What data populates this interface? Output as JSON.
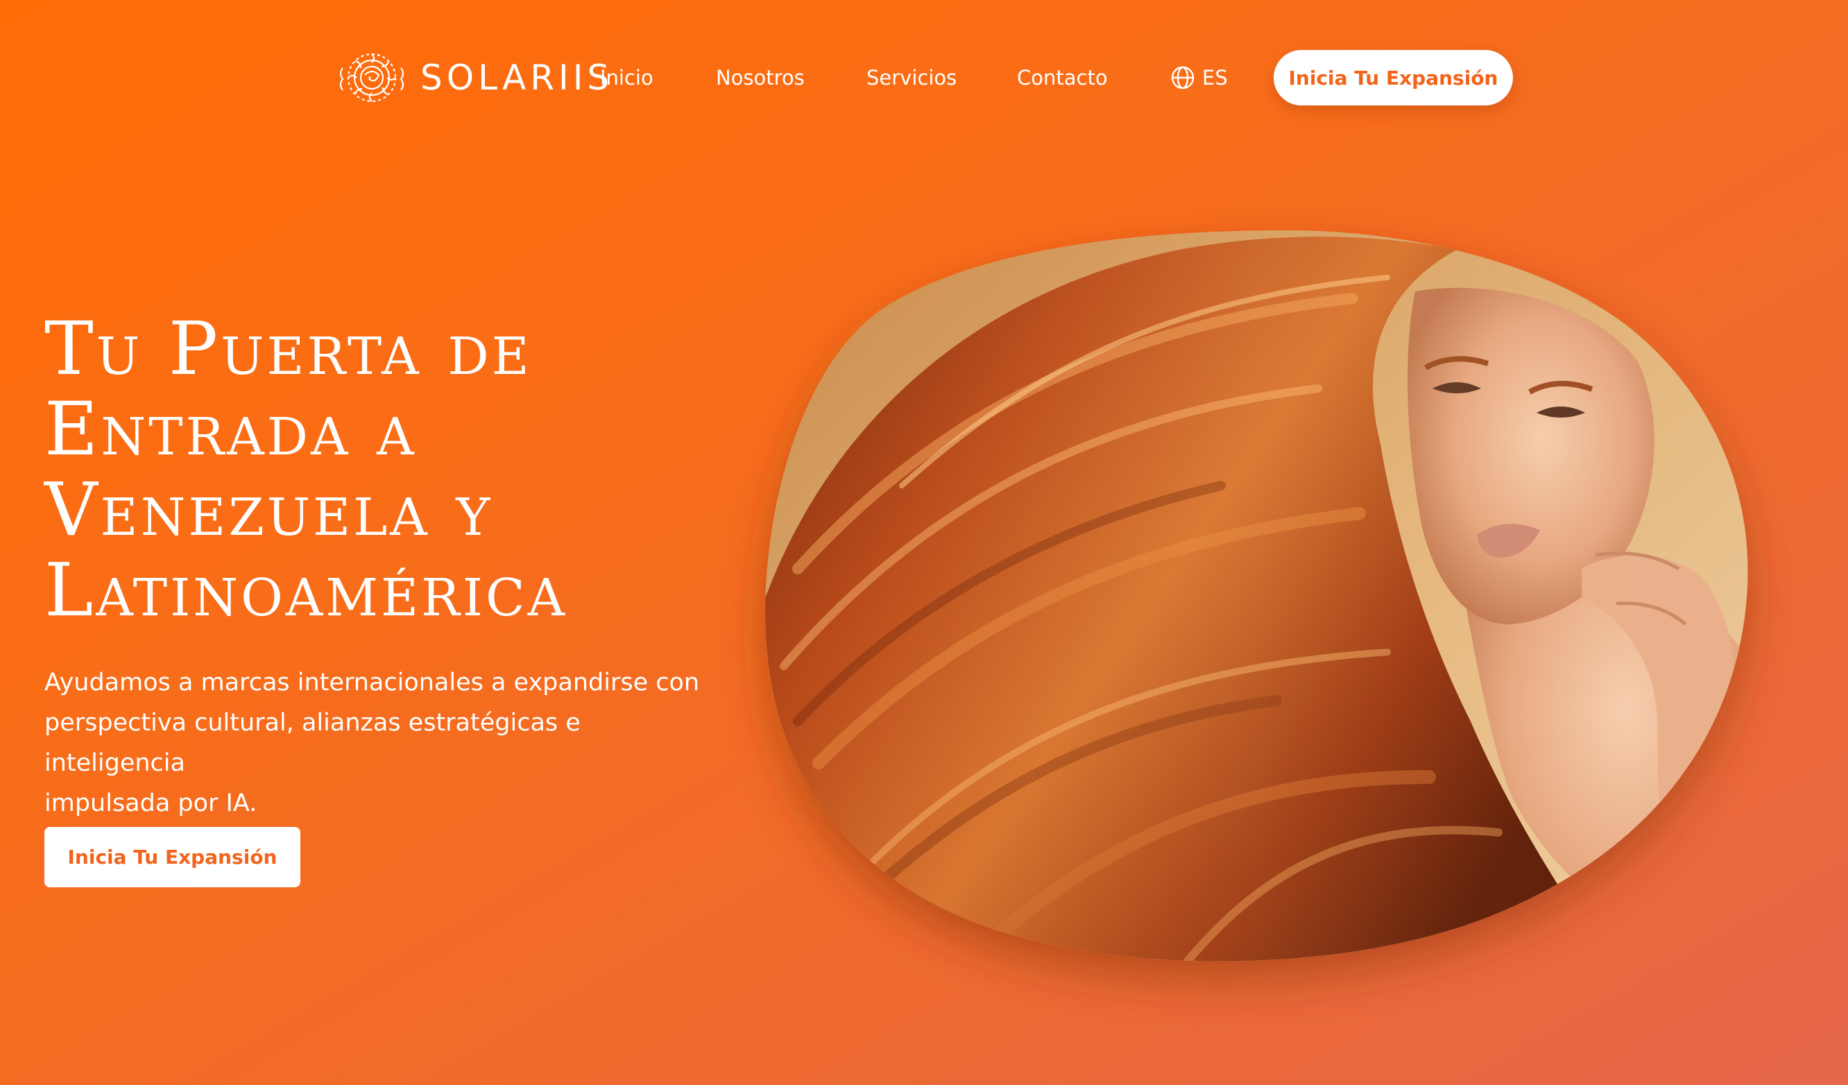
{
  "brand": {
    "name": "SOLARIIS"
  },
  "nav": {
    "items": [
      {
        "label": "Inicio"
      },
      {
        "label": "Nosotros"
      },
      {
        "label": "Servicios"
      },
      {
        "label": "Contacto"
      }
    ],
    "language": {
      "icon": "globe-icon",
      "label": "ES"
    },
    "cta_label": "Inicia Tu Expansión"
  },
  "hero": {
    "title_lines": [
      "Tu Puerta de",
      "Entrada a",
      "Venezuela y",
      "Latinoamérica"
    ],
    "subtitle_lines": [
      "Ayudamos a marcas internacionales a expandirse con",
      "perspectiva cultural, alianzas estratégicas e inteligencia",
      "impulsada por IA."
    ],
    "cta_label": "Inicia Tu Expansión",
    "image": "portrait-red-hair-woman"
  },
  "colors": {
    "accent": "#f2641c",
    "background_start": "#ff6c06",
    "background_end": "#e5664a",
    "button_bg": "#ffffff"
  }
}
